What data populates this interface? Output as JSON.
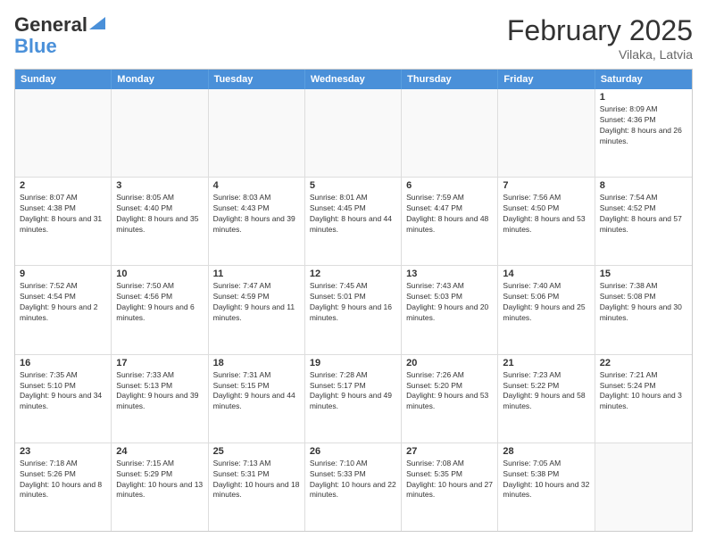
{
  "logo": {
    "line1": "General",
    "line2": "Blue"
  },
  "title": "February 2025",
  "subtitle": "Vilaka, Latvia",
  "days": [
    "Sunday",
    "Monday",
    "Tuesday",
    "Wednesday",
    "Thursday",
    "Friday",
    "Saturday"
  ],
  "rows": [
    [
      {
        "num": "",
        "info": ""
      },
      {
        "num": "",
        "info": ""
      },
      {
        "num": "",
        "info": ""
      },
      {
        "num": "",
        "info": ""
      },
      {
        "num": "",
        "info": ""
      },
      {
        "num": "",
        "info": ""
      },
      {
        "num": "1",
        "info": "Sunrise: 8:09 AM\nSunset: 4:36 PM\nDaylight: 8 hours and 26 minutes."
      }
    ],
    [
      {
        "num": "2",
        "info": "Sunrise: 8:07 AM\nSunset: 4:38 PM\nDaylight: 8 hours and 31 minutes."
      },
      {
        "num": "3",
        "info": "Sunrise: 8:05 AM\nSunset: 4:40 PM\nDaylight: 8 hours and 35 minutes."
      },
      {
        "num": "4",
        "info": "Sunrise: 8:03 AM\nSunset: 4:43 PM\nDaylight: 8 hours and 39 minutes."
      },
      {
        "num": "5",
        "info": "Sunrise: 8:01 AM\nSunset: 4:45 PM\nDaylight: 8 hours and 44 minutes."
      },
      {
        "num": "6",
        "info": "Sunrise: 7:59 AM\nSunset: 4:47 PM\nDaylight: 8 hours and 48 minutes."
      },
      {
        "num": "7",
        "info": "Sunrise: 7:56 AM\nSunset: 4:50 PM\nDaylight: 8 hours and 53 minutes."
      },
      {
        "num": "8",
        "info": "Sunrise: 7:54 AM\nSunset: 4:52 PM\nDaylight: 8 hours and 57 minutes."
      }
    ],
    [
      {
        "num": "9",
        "info": "Sunrise: 7:52 AM\nSunset: 4:54 PM\nDaylight: 9 hours and 2 minutes."
      },
      {
        "num": "10",
        "info": "Sunrise: 7:50 AM\nSunset: 4:56 PM\nDaylight: 9 hours and 6 minutes."
      },
      {
        "num": "11",
        "info": "Sunrise: 7:47 AM\nSunset: 4:59 PM\nDaylight: 9 hours and 11 minutes."
      },
      {
        "num": "12",
        "info": "Sunrise: 7:45 AM\nSunset: 5:01 PM\nDaylight: 9 hours and 16 minutes."
      },
      {
        "num": "13",
        "info": "Sunrise: 7:43 AM\nSunset: 5:03 PM\nDaylight: 9 hours and 20 minutes."
      },
      {
        "num": "14",
        "info": "Sunrise: 7:40 AM\nSunset: 5:06 PM\nDaylight: 9 hours and 25 minutes."
      },
      {
        "num": "15",
        "info": "Sunrise: 7:38 AM\nSunset: 5:08 PM\nDaylight: 9 hours and 30 minutes."
      }
    ],
    [
      {
        "num": "16",
        "info": "Sunrise: 7:35 AM\nSunset: 5:10 PM\nDaylight: 9 hours and 34 minutes."
      },
      {
        "num": "17",
        "info": "Sunrise: 7:33 AM\nSunset: 5:13 PM\nDaylight: 9 hours and 39 minutes."
      },
      {
        "num": "18",
        "info": "Sunrise: 7:31 AM\nSunset: 5:15 PM\nDaylight: 9 hours and 44 minutes."
      },
      {
        "num": "19",
        "info": "Sunrise: 7:28 AM\nSunset: 5:17 PM\nDaylight: 9 hours and 49 minutes."
      },
      {
        "num": "20",
        "info": "Sunrise: 7:26 AM\nSunset: 5:20 PM\nDaylight: 9 hours and 53 minutes."
      },
      {
        "num": "21",
        "info": "Sunrise: 7:23 AM\nSunset: 5:22 PM\nDaylight: 9 hours and 58 minutes."
      },
      {
        "num": "22",
        "info": "Sunrise: 7:21 AM\nSunset: 5:24 PM\nDaylight: 10 hours and 3 minutes."
      }
    ],
    [
      {
        "num": "23",
        "info": "Sunrise: 7:18 AM\nSunset: 5:26 PM\nDaylight: 10 hours and 8 minutes."
      },
      {
        "num": "24",
        "info": "Sunrise: 7:15 AM\nSunset: 5:29 PM\nDaylight: 10 hours and 13 minutes."
      },
      {
        "num": "25",
        "info": "Sunrise: 7:13 AM\nSunset: 5:31 PM\nDaylight: 10 hours and 18 minutes."
      },
      {
        "num": "26",
        "info": "Sunrise: 7:10 AM\nSunset: 5:33 PM\nDaylight: 10 hours and 22 minutes."
      },
      {
        "num": "27",
        "info": "Sunrise: 7:08 AM\nSunset: 5:35 PM\nDaylight: 10 hours and 27 minutes."
      },
      {
        "num": "28",
        "info": "Sunrise: 7:05 AM\nSunset: 5:38 PM\nDaylight: 10 hours and 32 minutes."
      },
      {
        "num": "",
        "info": ""
      }
    ]
  ]
}
